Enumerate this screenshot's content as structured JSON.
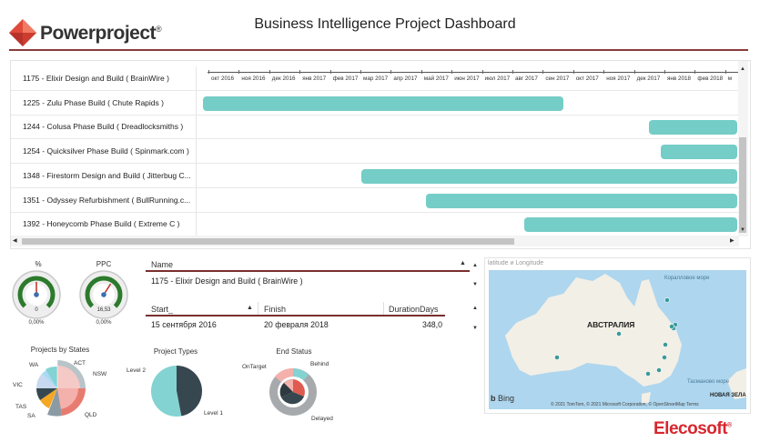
{
  "header": {
    "brand": "Powerproject",
    "reg": "®",
    "title": "Business Intelligence Project Dashboard"
  },
  "gantt": {
    "rows": [
      {
        "label": "1175 - Elixir Design and Build ( BrainWire )"
      },
      {
        "label": "1225 - Zulu Phase Build ( Chute Rapids )",
        "start_frac": 0.0,
        "end_frac": 0.674
      },
      {
        "label": "1244 - Colusa Phase Build ( Dreadlocksmiths )",
        "start_frac": 0.834,
        "end_frac": 1.0
      },
      {
        "label": "1254 - Quicksilver Phase Build ( Spinmark.com )",
        "start_frac": 0.857,
        "end_frac": 1.0
      },
      {
        "label": "1348 - Firestorm Design and Build ( Jitterbug C...",
        "start_frac": 0.297,
        "end_frac": 1.0
      },
      {
        "label": "1351 - Odyssey Refurbishment ( BullRunning.c...",
        "start_frac": 0.418,
        "end_frac": 1.0
      },
      {
        "label": "1392 - Honeycomb Phase Build ( Extreme C )",
        "start_frac": 0.602,
        "end_frac": 1.0
      }
    ],
    "months": [
      "окт 2016",
      "ноя 2016",
      "дек 2016",
      "янв 2017",
      "фев 2017",
      "мар 2017",
      "апр 2017",
      "май 2017",
      "июн 2017",
      "июл 2017",
      "авг 2017",
      "сен 2017",
      "окт 2017",
      "ноя 2017",
      "дек 2017",
      "янв 2018",
      "фев 2018",
      "м"
    ]
  },
  "gauges": [
    {
      "title": "%",
      "value": "0",
      "min_label": "0,00%",
      "max_label": "0,00%",
      "value_frac": 0.5
    },
    {
      "title": "PPC",
      "value": "16,53",
      "min_label": "0,00%",
      "max_label": "0,00%",
      "value_frac": 0.62
    }
  ],
  "name_table": {
    "header": "Name",
    "value": "1175 - Elixir Design and Build ( BrainWire )"
  },
  "date_table": {
    "headers": [
      "Start_",
      "Finish",
      "DurationDays"
    ],
    "values": [
      "15 сентября 2016",
      "20 февраля 2018",
      "348,0"
    ]
  },
  "projects_by_states": {
    "title": "Projects by States",
    "labels": [
      "WA",
      "ACT",
      "NSW",
      "VIC",
      "TAS",
      "SA",
      "QLD"
    ]
  },
  "project_types": {
    "title": "Project Types",
    "labels": [
      "Level 2",
      "Level 1"
    ],
    "values": [
      47,
      53
    ],
    "colors": [
      "#37474f",
      "#82d3d2"
    ]
  },
  "end_status": {
    "title": "End Status",
    "labels": [
      "OnTarget",
      "Behind",
      "Delayed"
    ]
  },
  "map": {
    "field_label": "latitude и Longitude",
    "country": "АВСТРАЛИЯ",
    "sea_top": "Коралловое море",
    "sea_right": "Тасманово море",
    "nz": "НОВАЯ ЗЕЛА",
    "bing": "Bing",
    "copyright": "© 2021 TomTom, © 2021 Microsoft Corporation, © OpenStreetMap Terms",
    "water": "#aed6ee",
    "land": "#f2efe6"
  },
  "footer": {
    "brand": "Elecosoft",
    "reg": "®"
  },
  "colors": {
    "accent": "#7a2e2e",
    "bar": "#74cdc6",
    "map_dot": "#3a9a9a"
  }
}
